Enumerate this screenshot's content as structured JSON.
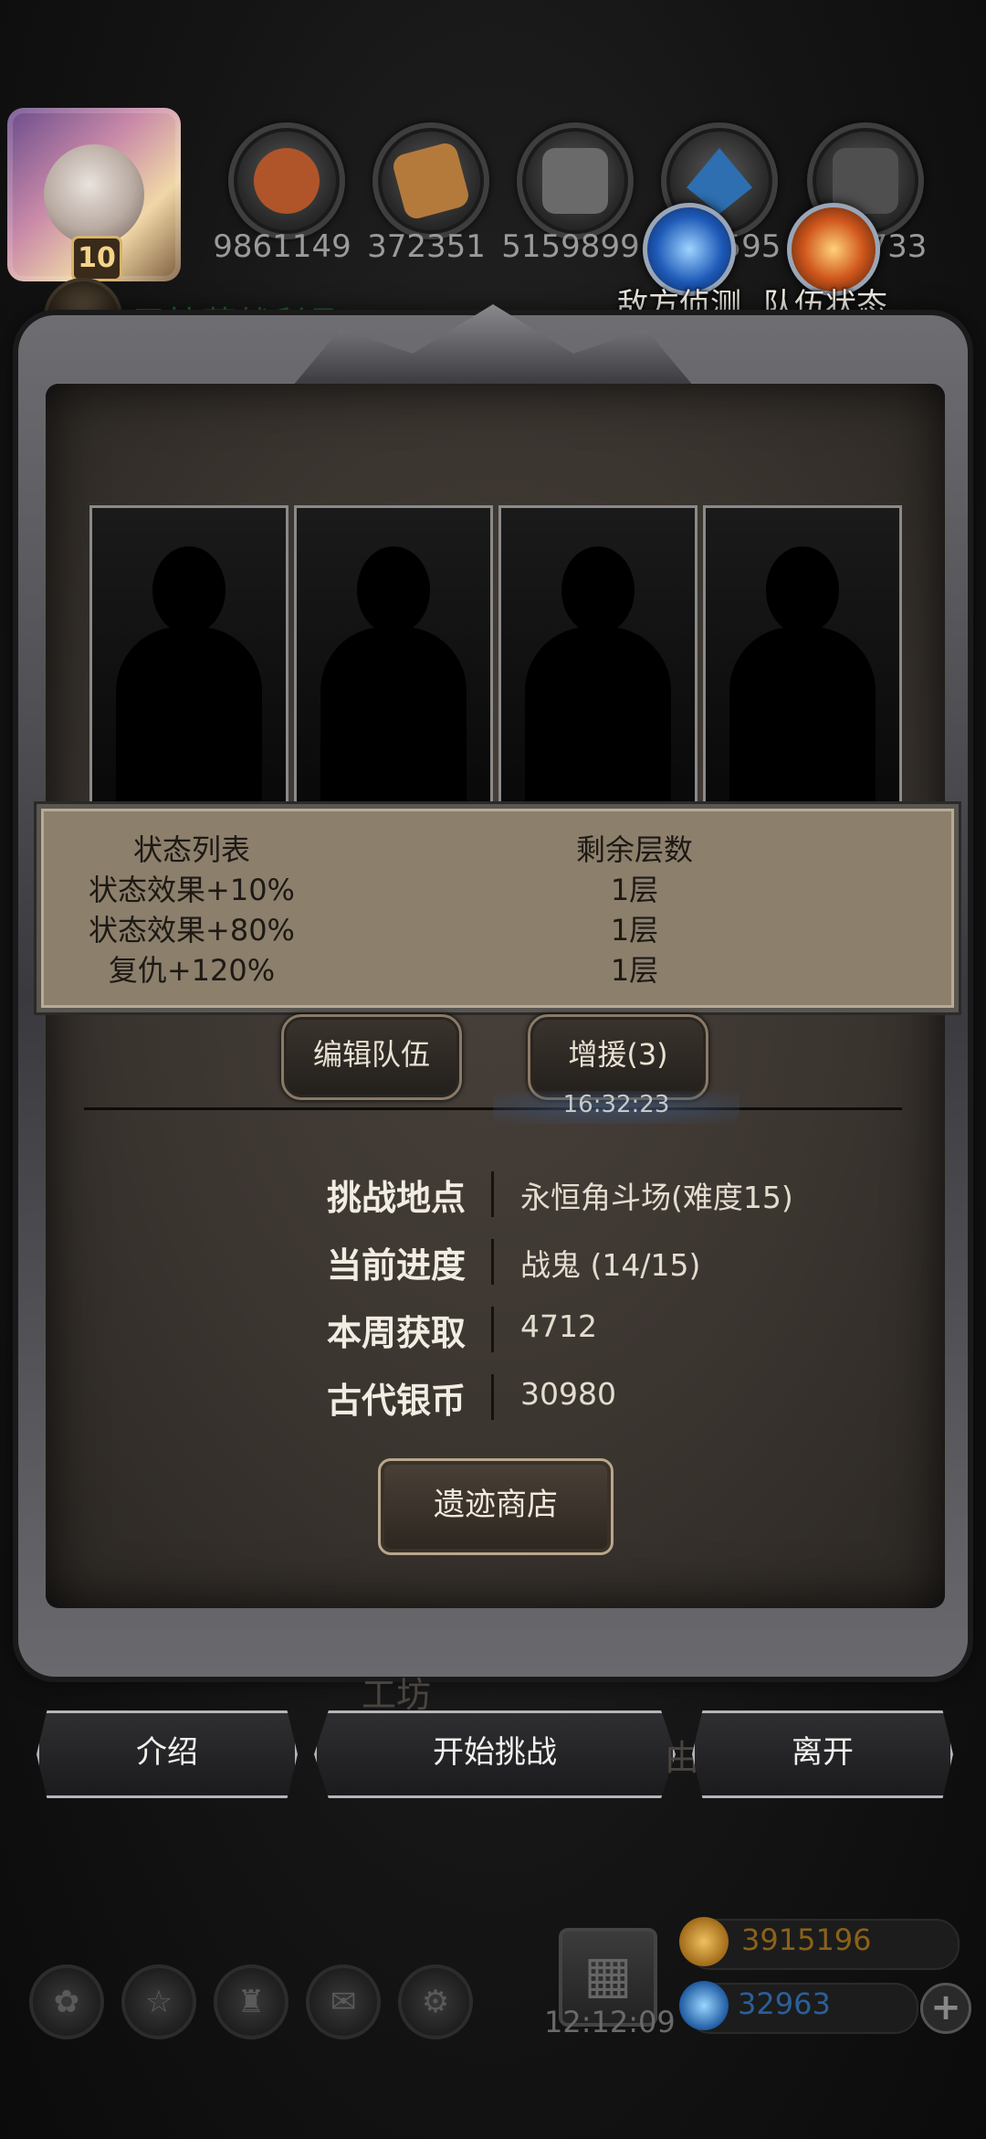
{
  "resources": [
    {
      "icon": "meat-icon",
      "value": "9861149",
      "color": "#b0552a"
    },
    {
      "icon": "wood-icon",
      "value": "372351",
      "color": "#b47a3c"
    },
    {
      "icon": "iron-icon",
      "value": "5159899",
      "color": "#6a6a6a"
    },
    {
      "icon": "crystal-icon",
      "value": "595",
      "color": "#2d6fb0"
    },
    {
      "icon": "ore-icon",
      "value": "733",
      "color": "#5a5a5a"
    }
  ],
  "player": {
    "level": "10"
  },
  "drop_status": "已掉落战利品:5/5",
  "top_buttons": {
    "enemy_scout": "敌方侦测",
    "team_status": "队伍状态"
  },
  "status_table": {
    "header_status": "状态列表",
    "header_layers": "剩余层数",
    "rows": [
      {
        "name": "状态效果+10%",
        "layers": "1层"
      },
      {
        "name": "状态效果+80%",
        "layers": "1层"
      },
      {
        "name": "复仇+120%",
        "layers": "1层"
      }
    ]
  },
  "actions": {
    "edit_team": "编辑队伍",
    "reinforce": "增援(3)",
    "timer": "16:32:23"
  },
  "info": {
    "location_label": "挑战地点",
    "location_value": "永恒角斗场(难度15)",
    "progress_label": "当前进度",
    "progress_value": "战鬼 (14/15)",
    "weekly_label": "本周获取",
    "weekly_value": "4712",
    "silver_label": "古代银币",
    "silver_value": "30980"
  },
  "shop_button": "遗迹商店",
  "background_labels": {
    "workshop": "工坊",
    "partial": "由"
  },
  "bottom_buttons": {
    "intro": "介绍",
    "start": "开始挑战",
    "leave": "离开"
  },
  "hud": {
    "time": "12:12:09",
    "gold": "3915196",
    "gems": "32963",
    "plus": "+"
  },
  "nav_icons": [
    "settings-icon",
    "medal-icon",
    "castle-icon",
    "mail-icon",
    "gear-sword-icon"
  ]
}
